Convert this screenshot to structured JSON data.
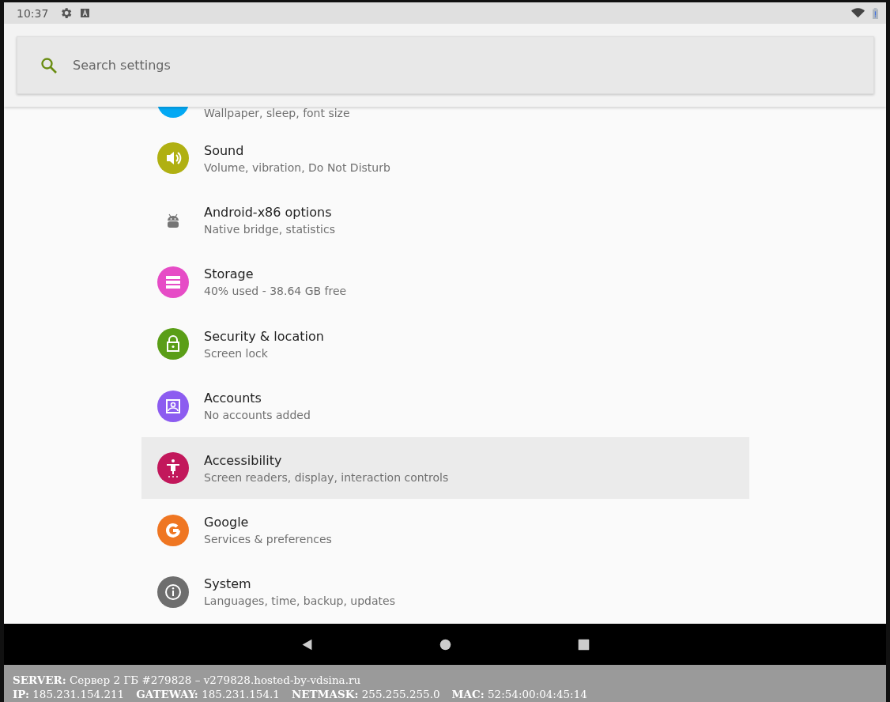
{
  "status_bar": {
    "time": "10:37"
  },
  "search": {
    "placeholder": "Search settings"
  },
  "items": [
    {
      "kind": "display",
      "color": "#03a9f4",
      "subtitle": "Wallpaper, sleep, font size",
      "selected": false
    },
    {
      "kind": "sound",
      "color": "#b0b012",
      "title": "Sound",
      "subtitle": "Volume, vibration, Do Not Disturb",
      "selected": false
    },
    {
      "kind": "android",
      "color": "#757575",
      "title": "Android-x86 options",
      "subtitle": "Native bridge, statistics",
      "selected": false
    },
    {
      "kind": "storage",
      "color": "#e64cc6",
      "title": "Storage",
      "subtitle": "40% used - 38.64 GB free",
      "selected": false
    },
    {
      "kind": "security",
      "color": "#5a9e17",
      "title": "Security & location",
      "subtitle": "Screen lock",
      "selected": false
    },
    {
      "kind": "accounts",
      "color": "#8c5cf0",
      "title": "Accounts",
      "subtitle": "No accounts added",
      "selected": false
    },
    {
      "kind": "accessibility",
      "color": "#c2185b",
      "title": "Accessibility",
      "subtitle": "Screen readers, display, interaction controls",
      "selected": true
    },
    {
      "kind": "google",
      "color": "#ef7622",
      "title": "Google",
      "subtitle": "Services & preferences",
      "selected": false
    },
    {
      "kind": "system",
      "color": "#6e6e6e",
      "title": "System",
      "subtitle": "Languages, time, backup, updates",
      "selected": false
    }
  ],
  "footer": {
    "server": "**SERVER:** Сервер 2 ГБ #279828 – v279828.hosted-by-vdsina.ru",
    "fields": [
      "**IP:** 185.231.154.211",
      "**GATEWAY:** 185.231.154.1",
      "**NETMASK:** 255.255.255.0",
      "**MAC:** 52:54:00:04:45:14"
    ]
  }
}
